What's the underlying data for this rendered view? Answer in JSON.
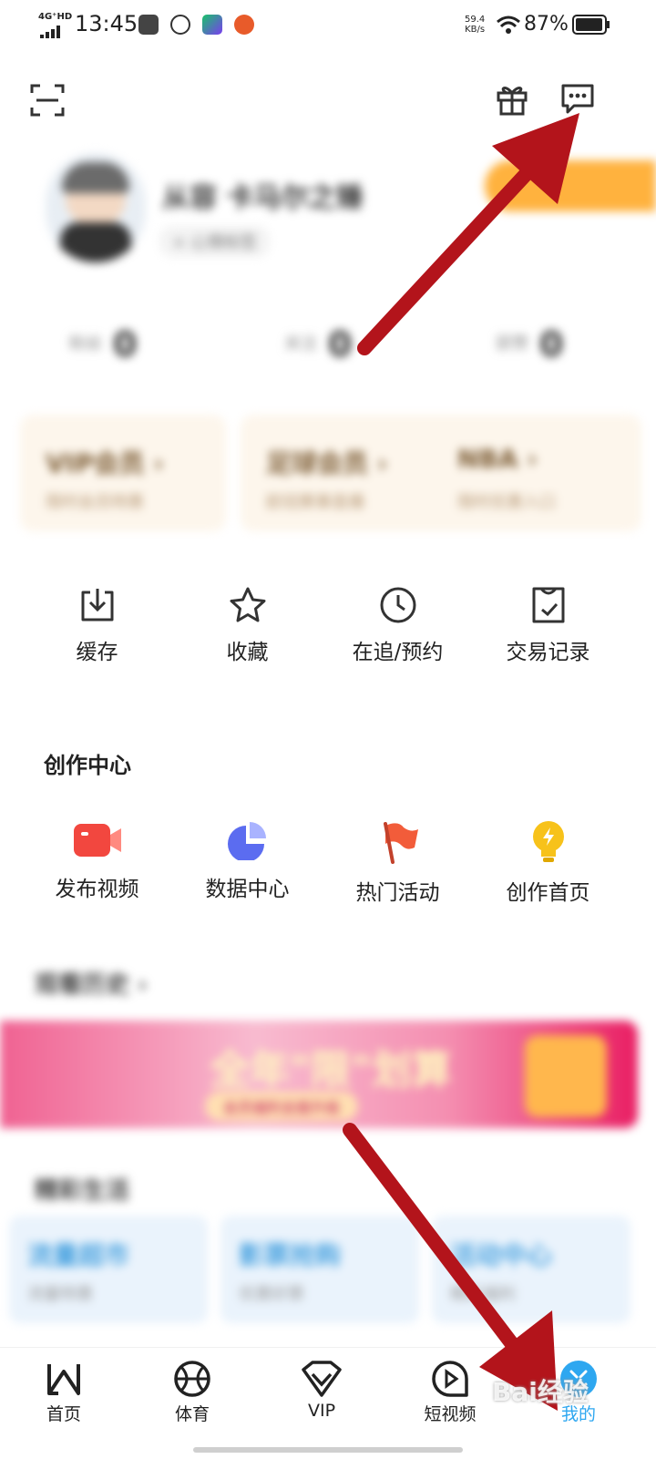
{
  "status_bar": {
    "network": "4G⁺HD",
    "time": "13:45",
    "speed_value": "59.4",
    "speed_unit": "KB/s",
    "battery": "87%"
  },
  "profile": {
    "username": "从容 卡马尔之锤",
    "tag": "+ 心情标签",
    "stats": [
      {
        "label": "粉丝",
        "value": "0"
      },
      {
        "label": "关注",
        "value": "0"
      },
      {
        "label": "获赞",
        "value": "0"
      }
    ]
  },
  "member_cards": [
    {
      "title": "VIP会员 ›",
      "subtitle": "限时会员特惠"
    },
    {
      "title": "足球会员 ›",
      "subtitle": "欧冠赛事直播"
    },
    {
      "title": "NBA ›",
      "subtitle": "限时优惠入口"
    }
  ],
  "tools": [
    {
      "label": "缓存",
      "icon": "download-icon"
    },
    {
      "label": "收藏",
      "icon": "star-icon"
    },
    {
      "label": "在追/预约",
      "icon": "clock-icon"
    },
    {
      "label": "交易记录",
      "icon": "receipt-icon"
    }
  ],
  "creation_center": {
    "title": "创作中心",
    "items": [
      {
        "label": "发布视频",
        "icon": "video-camera-icon",
        "color": "#f2473f"
      },
      {
        "label": "数据中心",
        "icon": "pie-chart-icon",
        "color": "#5b6cf0"
      },
      {
        "label": "热门活动",
        "icon": "flag-icon",
        "color": "#f25c3a"
      },
      {
        "label": "创作首页",
        "icon": "lightbulb-icon",
        "color": "#f7c21a"
      }
    ]
  },
  "history": {
    "title": "观看历史 ›"
  },
  "banner": {
    "headline": "全年\"限\"划算",
    "sub": "会员福利全面升级"
  },
  "life": {
    "title": "精彩生活",
    "cards": [
      {
        "title": "流量超市",
        "subtitle": "流量特惠"
      },
      {
        "title": "影票抢购",
        "subtitle": "优惠好票"
      },
      {
        "title": "活动中心",
        "subtitle": "精彩福利"
      }
    ]
  },
  "nav": [
    {
      "label": "首页",
      "icon": "home-icon"
    },
    {
      "label": "体育",
      "icon": "basketball-icon"
    },
    {
      "label": "VIP",
      "icon": "vip-icon"
    },
    {
      "label": "短视频",
      "icon": "short-video-icon"
    },
    {
      "label": "我的",
      "icon": "my-icon",
      "active": true
    }
  ],
  "watermark": "Bai经验",
  "colors": {
    "accent": "#2ea7f0",
    "arrow": "#b3141b",
    "vip": "#ffb23e"
  }
}
